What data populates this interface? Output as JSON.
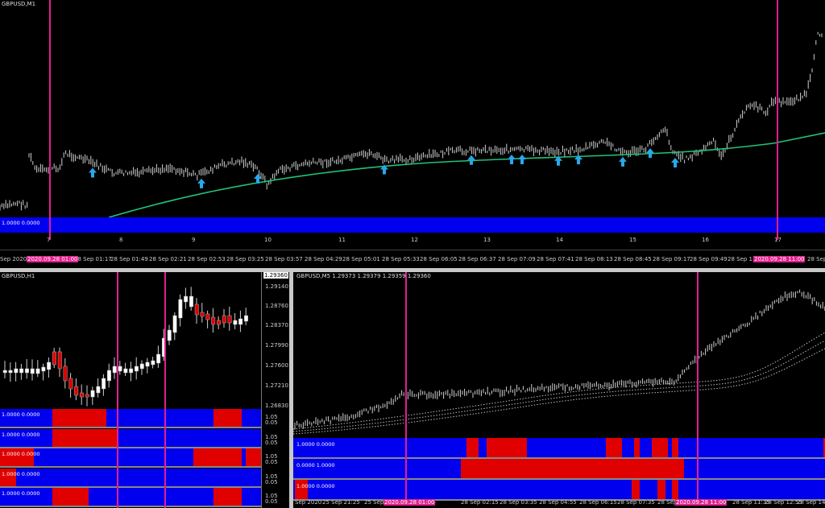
{
  "main_chart": {
    "title": "GBPUSD,M1",
    "indicator_label": "1.0000 0.0000",
    "number_ticks": [
      "7",
      "8",
      "9",
      "10",
      "11",
      "12",
      "13",
      "14",
      "15",
      "16",
      "17"
    ],
    "date_ticks": [
      "Sep 2020",
      "28 Sep 01:17",
      "28 Sep 01:49",
      "28 Sep 02:21",
      "28 Sep 02:53",
      "28 Sep 03:25",
      "28 Sep 03:57",
      "28 Sep 04:29",
      "28 Sep 05:01",
      "28 Sep 05:33",
      "28 Sep 06:05",
      "28 Sep 06:37",
      "28 Sep 07:09",
      "28 Sep 07:41",
      "28 Sep 08:13",
      "28 Sep 08:45",
      "28 Sep 09:17",
      "28 Sep 09:49",
      "28 Sep 1",
      "28 Sep"
    ],
    "highlight_left": "2020.09.28 01:00",
    "highlight_right": "2020.09.28 11:00",
    "ma_color": "#21c27a",
    "arrow_color": "#29a8e8",
    "arrow_icon": "up-arrow-icon"
  },
  "h1_chart": {
    "title": "GBPUSD,H1",
    "price_labels": [
      "1.29140",
      "1.28760",
      "1.28370",
      "1.27990",
      "1.27600",
      "1.27210",
      "1.26830"
    ],
    "current_price": "1.29360",
    "indicators": [
      {
        "label": "1.0000 0.0000",
        "axis": [
          "1.05",
          "0.05"
        ]
      },
      {
        "label": "1.0000 0.0000",
        "axis": [
          "1.05",
          "0.05"
        ]
      },
      {
        "label": "1.0000 0.0000",
        "axis": [
          "1.05",
          "0.05"
        ]
      },
      {
        "label": "1.0000 0.0000",
        "axis": [
          "1.05",
          "0.05"
        ]
      },
      {
        "label": "1.0000 0.0000",
        "axis": [
          "1.05",
          "0.05"
        ]
      }
    ]
  },
  "m5_chart": {
    "title": "GBPUSD,M5  1.29373 1.29379 1.29359 1.29360",
    "indicators": [
      {
        "label": "1.0000 0.0000"
      },
      {
        "label": "0.0000 1.0000"
      },
      {
        "label": "1.0000 0.0000"
      }
    ],
    "date_ticks": [
      "Sep 2020",
      "25 Sep 21:25",
      "25 Sep",
      "55",
      "28 Sep 02:15",
      "28 Sep 03:35",
      "28 Sep 04:55",
      "28 Sep 06:15",
      "28 Sep 07:35",
      "28 Sep 08:55",
      "28 Sep 11:35",
      "28 Sep 12:55",
      "28 Sep 14:15"
    ],
    "highlight_left": "2020.09.28 01:00",
    "highlight_right": "2020.09.28 11:00"
  },
  "colors": {
    "background": "#000000",
    "indicator_blue": "#0000ee",
    "indicator_red": "#e00000",
    "vertical_line": "#e0208c"
  }
}
